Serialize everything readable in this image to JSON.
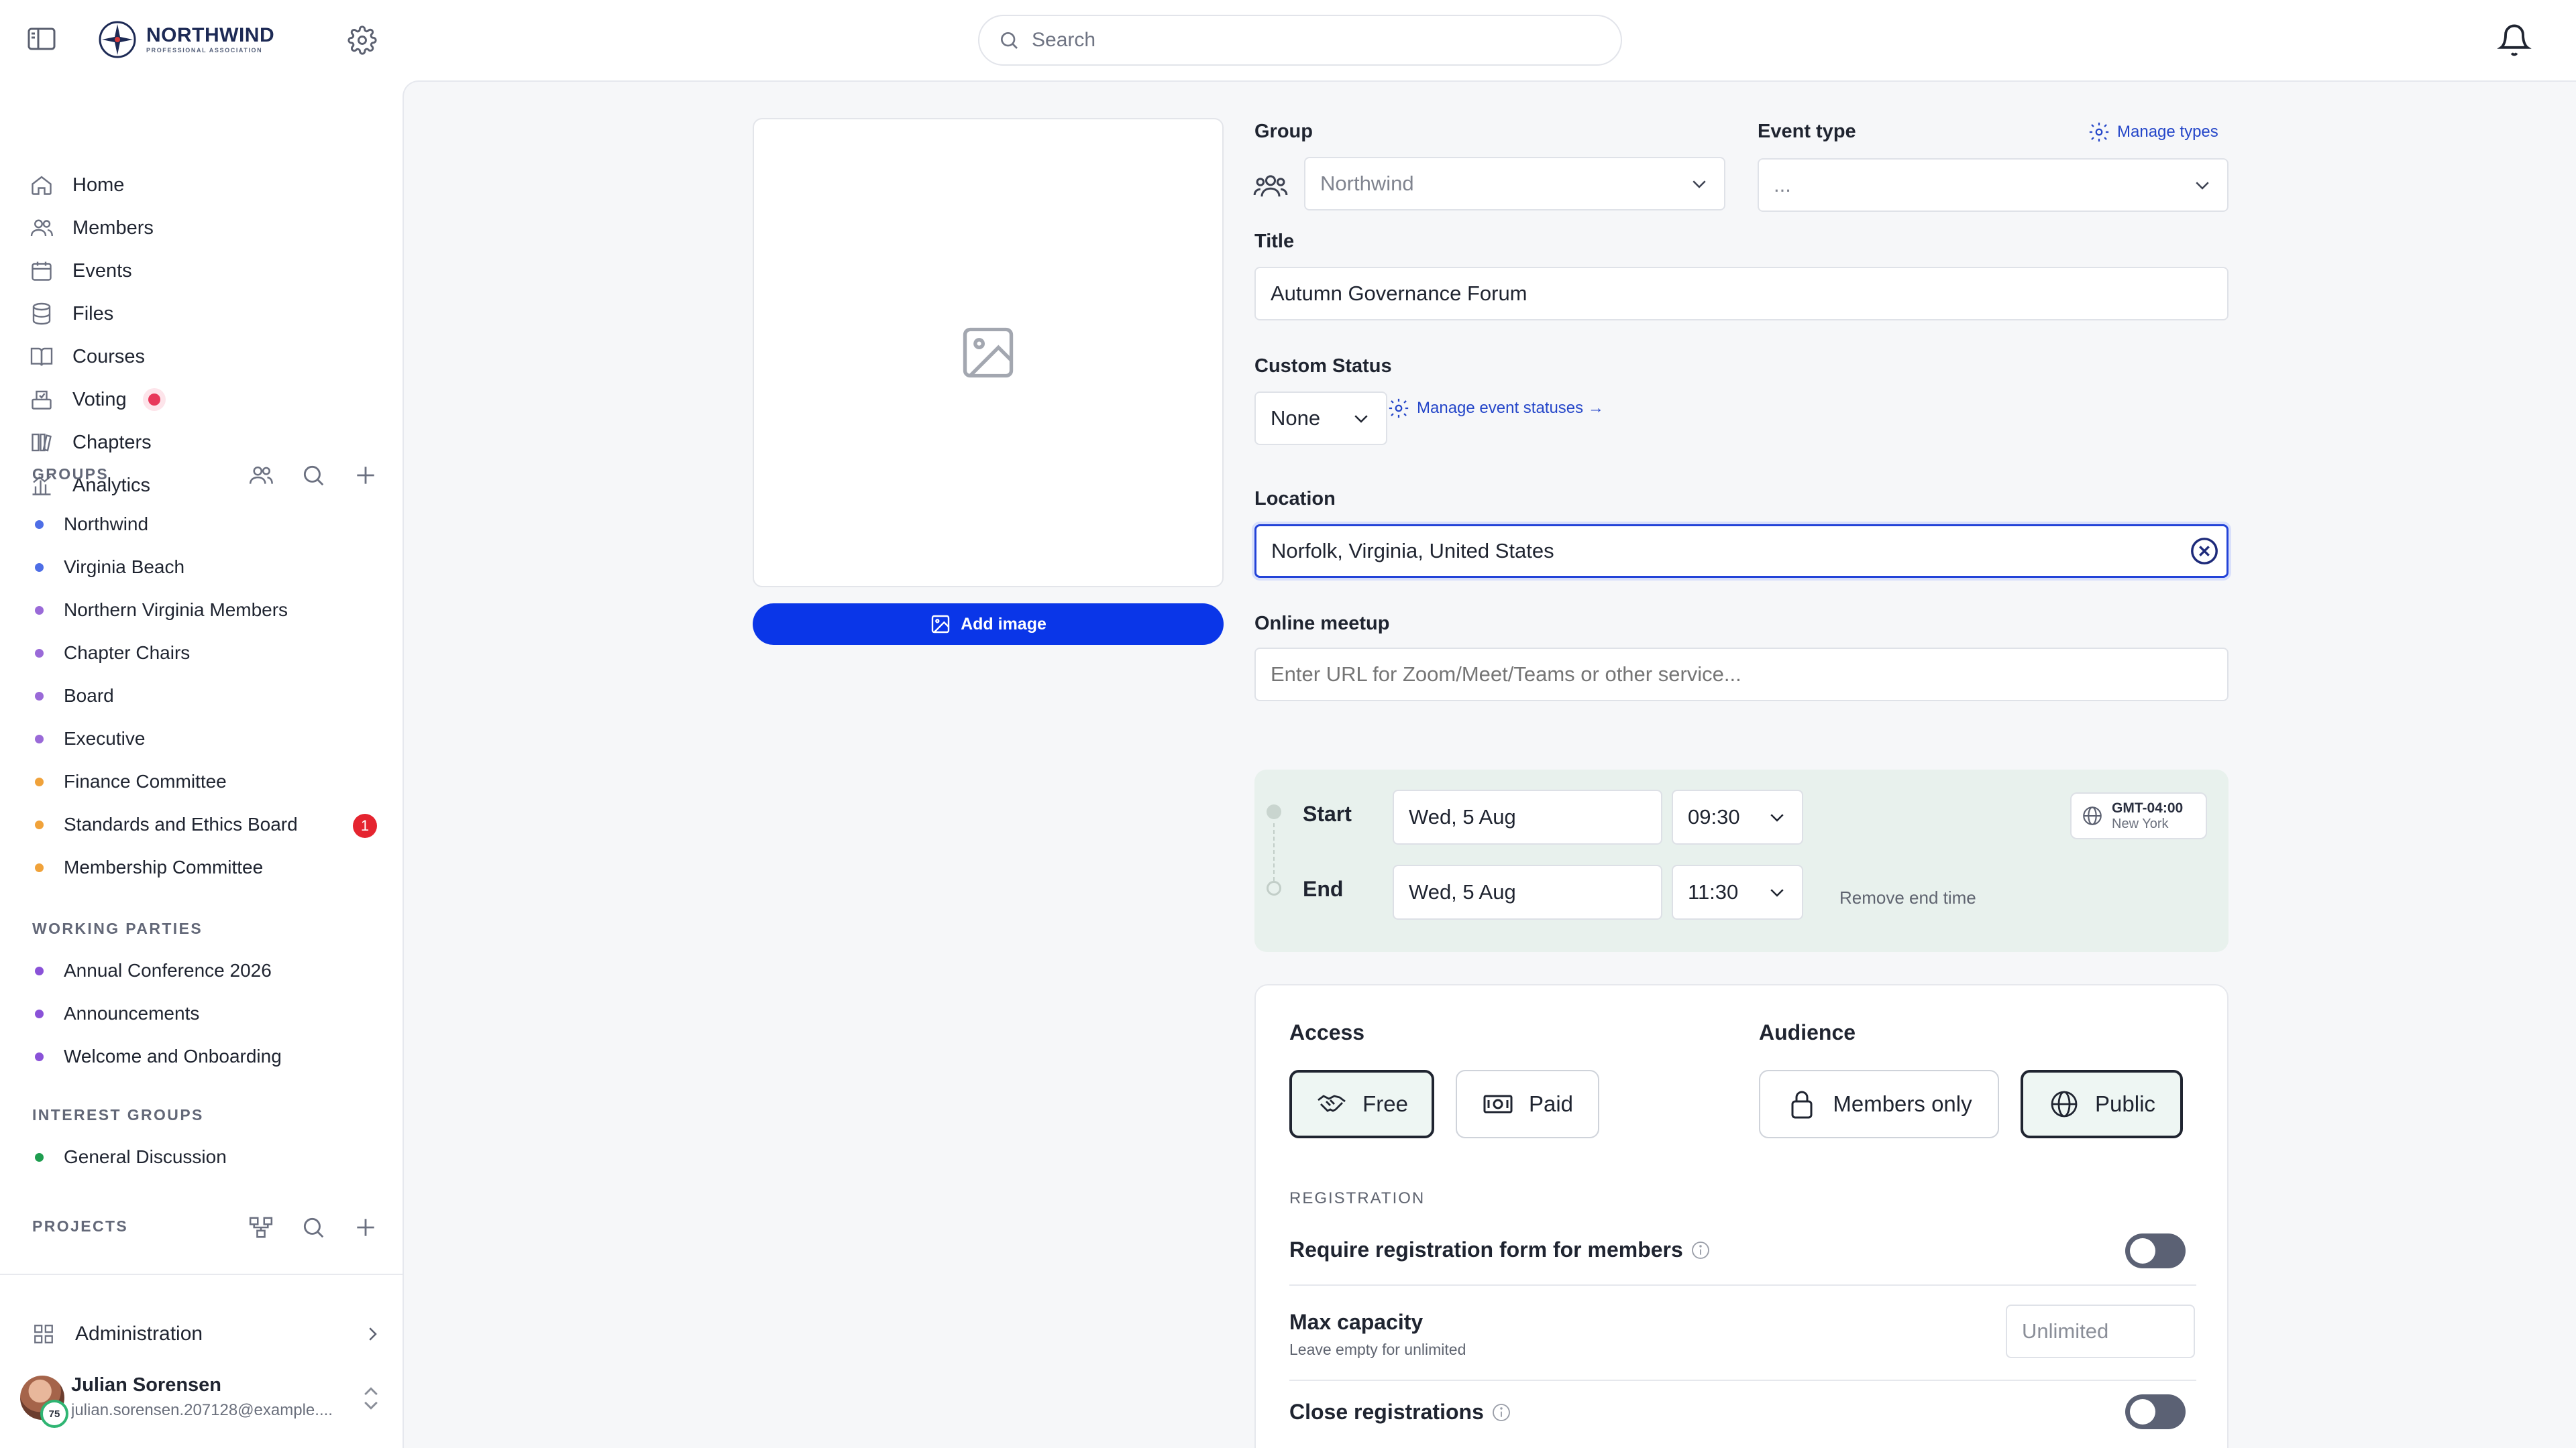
{
  "brand": {
    "name": "NORTHWIND",
    "tagline": "PROFESSIONAL ASSOCIATION"
  },
  "search": {
    "placeholder": "Search"
  },
  "nav": [
    {
      "label": "Home",
      "icon": "home-icon"
    },
    {
      "label": "Members",
      "icon": "members-icon"
    },
    {
      "label": "Events",
      "icon": "calendar-icon"
    },
    {
      "label": "Files",
      "icon": "database-icon"
    },
    {
      "label": "Courses",
      "icon": "book-icon"
    },
    {
      "label": "Voting",
      "icon": "ballot-icon"
    },
    {
      "label": "Chapters",
      "icon": "chapters-icon"
    },
    {
      "label": "Analytics",
      "icon": "analytics-icon"
    }
  ],
  "groups": {
    "title": "GROUPS",
    "items": [
      {
        "label": "Northwind",
        "color": "#4e6ee6"
      },
      {
        "label": "Virginia Beach",
        "color": "#4e6ee6"
      },
      {
        "label": "Northern Virginia Members",
        "color": "#9a6ad8"
      },
      {
        "label": "Chapter Chairs",
        "color": "#9a6ad8"
      },
      {
        "label": "Board",
        "color": "#9a6ad8"
      },
      {
        "label": "Executive",
        "color": "#9a6ad8"
      },
      {
        "label": "Finance Committee",
        "color": "#f0a23a"
      },
      {
        "label": "Standards and Ethics Board",
        "color": "#f0a23a",
        "badge": "1"
      },
      {
        "label": "Membership Committee",
        "color": "#f0a23a"
      }
    ]
  },
  "working_parties": {
    "title": "WORKING PARTIES",
    "items": [
      {
        "label": "Annual Conference 2026",
        "color": "#8a52d8"
      },
      {
        "label": "Announcements",
        "color": "#8a52d8"
      },
      {
        "label": "Welcome and Onboarding",
        "color": "#8a52d8"
      }
    ]
  },
  "interest_groups": {
    "title": "INTEREST GROUPS",
    "items": [
      {
        "label": "General Discussion",
        "color": "#1e9d4f"
      }
    ]
  },
  "projects": {
    "title": "PROJECTS"
  },
  "admin": {
    "label": "Administration"
  },
  "user": {
    "name": "Julian Sorensen",
    "email": "julian.sorensen.207128@example....",
    "score": "75"
  },
  "form": {
    "add_image_label": "Add image",
    "group": {
      "label": "Group",
      "value": "Northwind"
    },
    "event_type": {
      "label": "Event type",
      "value": "...",
      "manage_label": "Manage types"
    },
    "title": {
      "label": "Title",
      "value": "Autumn Governance Forum"
    },
    "custom_status": {
      "label": "Custom Status",
      "value": "None",
      "manage_label": "Manage event statuses →"
    },
    "location": {
      "label": "Location",
      "value": "Norfolk, Virginia, United States"
    },
    "online": {
      "label": "Online meetup",
      "placeholder": "Enter URL for Zoom/Meet/Teams or other service..."
    },
    "time": {
      "start_label": "Start",
      "start_date": "Wed, 5 Aug",
      "start_time": "09:30",
      "end_label": "End",
      "end_date": "Wed, 5 Aug",
      "end_time": "11:30",
      "tz_offset": "GMT-04:00",
      "tz_city": "New York",
      "remove_end_label": "Remove end time"
    },
    "access": {
      "title": "Access",
      "free_label": "Free",
      "paid_label": "Paid",
      "selected": "Free"
    },
    "audience": {
      "title": "Audience",
      "members_label": "Members only",
      "public_label": "Public",
      "selected": "Public"
    },
    "registration": {
      "title": "REGISTRATION",
      "require_label": "Require registration form for members",
      "require_on": false,
      "capacity_label": "Max capacity",
      "capacity_hint": "Leave empty for unlimited",
      "capacity_placeholder": "Unlimited",
      "close_label": "Close registrations",
      "close_on": false
    }
  }
}
